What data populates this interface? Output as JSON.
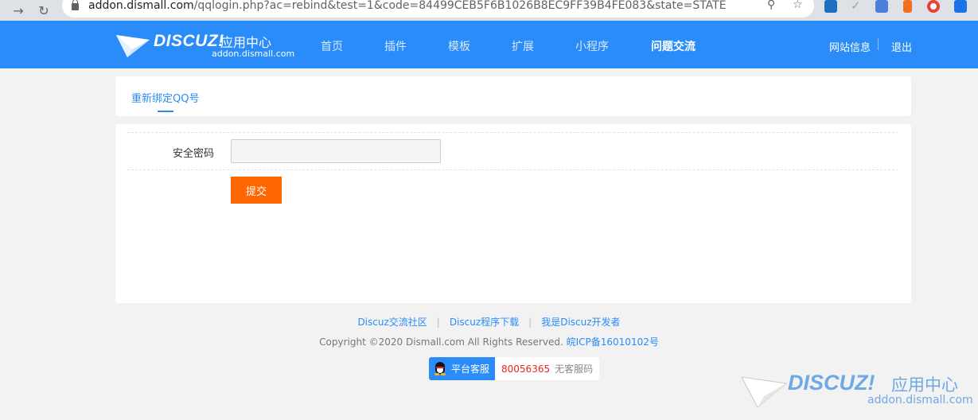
{
  "browser": {
    "url_host": "addon.dismall.com",
    "url_rest": "/qqlogin.php?ac=rebind&test=1&code=84499CEB5F6B1026B8EC9FF39B4FE083&state=STATE"
  },
  "header": {
    "logo_word": "DISCUZ!",
    "logo_cn": "应用中心",
    "logo_domain": "addon.dismall.com",
    "nav": [
      "首页",
      "插件",
      "模板",
      "扩展",
      "小程序",
      "问题交流"
    ],
    "right_links": [
      "网站信息",
      "退出"
    ]
  },
  "tab": {
    "label": "重新绑定QQ号"
  },
  "form": {
    "password_label": "安全密码",
    "password_value": "",
    "submit_label": "提交"
  },
  "footer": {
    "links": [
      "Discuz交流社区",
      "Discuz程序下载",
      "我是Discuz开发者"
    ],
    "separator": "|",
    "copyright": "Copyright ©2020 Dismall.com All Rights Reserved.",
    "icp": "皖ICP备16010102号",
    "service_label": "平台客服",
    "service_number": "80056365",
    "service_note": "无客服码"
  },
  "watermark": {
    "word": "DISCUZ!",
    "cn": "应用中心",
    "domain": "addon.dismall.com"
  },
  "colors": {
    "brand_blue": "#2a8cf9",
    "submit_orange": "#ff6600",
    "service_red": "#e8241e"
  }
}
